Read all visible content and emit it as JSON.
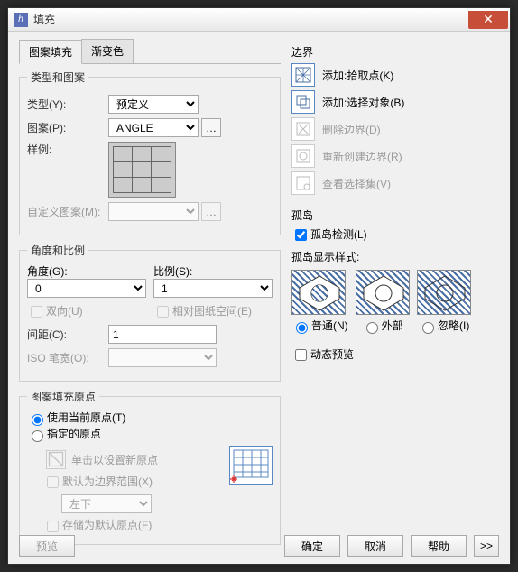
{
  "window": {
    "title": "填充"
  },
  "tabs": {
    "hatch": "图案填充",
    "gradient": "渐变色"
  },
  "groups": {
    "type_pattern": "类型和图案",
    "angle_scale": "角度和比例",
    "origin": "图案填充原点"
  },
  "type_pattern": {
    "type_label": "类型(Y):",
    "type_value": "预定义",
    "pattern_label": "图案(P):",
    "pattern_value": "ANGLE",
    "sample_label": "样例:",
    "custom_label": "自定义图案(M):"
  },
  "angle_scale": {
    "angle_label": "角度(G):",
    "angle_value": "0",
    "scale_label": "比例(S):",
    "scale_value": "1",
    "bidir_label": "双向(U)",
    "paperspace_label": "相对图纸空间(E)",
    "spacing_label": "间距(C):",
    "spacing_value": "1",
    "iso_label": "ISO 笔宽(O):"
  },
  "origin": {
    "use_current": "使用当前原点(T)",
    "specified": "指定的原点",
    "click_set": "单击以设置新原点",
    "default_extent": "默认为边界范围(X)",
    "extent_value": "左下",
    "store_default": "存储为默认原点(F)"
  },
  "boundary": {
    "title": "边界",
    "pick": "添加:拾取点(K)",
    "select": "添加:选择对象(B)",
    "remove": "删除边界(D)",
    "recreate": "重新创建边界(R)",
    "view": "查看选择集(V)"
  },
  "islands": {
    "title": "孤岛",
    "detect": "孤岛检测(L)",
    "style_label": "孤岛显示样式:",
    "normal": "普通(N)",
    "outer": "外部",
    "ignore": "忽略(I)"
  },
  "dynamic_preview": "动态预览",
  "buttons": {
    "preview": "预览",
    "ok": "确定",
    "cancel": "取消",
    "help": "帮助"
  }
}
